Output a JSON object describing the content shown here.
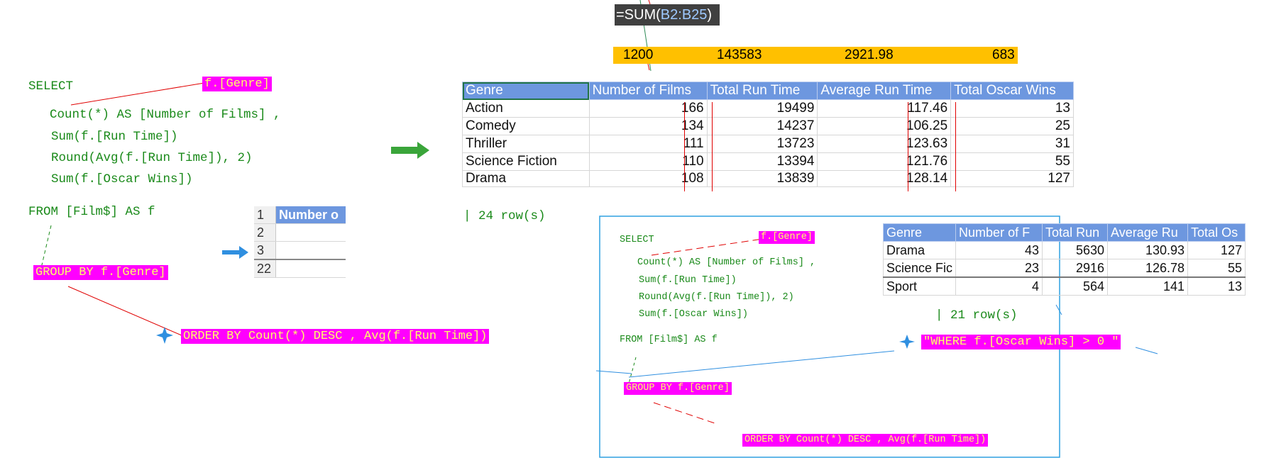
{
  "formula": {
    "prefix": "=SUM(",
    "ref": "B2:B25",
    "suffix": ")"
  },
  "totals": [
    "1200",
    "143583",
    "2921.98",
    "683"
  ],
  "left_query": {
    "select": "SELECT",
    "genre_tag": "f.[Genre]",
    "line_count": "Count(*) AS [Number of Films] ,",
    "line_sum_run": "Sum(f.[Run Time])",
    "line_round": "Round(Avg(f.[Run Time]), 2)",
    "line_sum_oscar": "Sum(f.[Oscar Wins])",
    "from": "FROM [Film$] AS f",
    "group_by": "GROUP BY f.[Genre]",
    "order_by": "ORDER BY Count(*) DESC , Avg(f.[Run Time])"
  },
  "main_table": {
    "headers": [
      "Genre",
      "Number of Films",
      "Total Run Time",
      "Average Run Time",
      "Total Oscar Wins"
    ],
    "rows": [
      [
        "Action",
        "166",
        "19499",
        "117.46",
        "13"
      ],
      [
        "Comedy",
        "134",
        "14237",
        "106.25",
        "25"
      ],
      [
        "Thriller",
        "111",
        "13723",
        "123.63",
        "31"
      ],
      [
        "Science Fiction",
        "110",
        "13394",
        "121.76",
        "55"
      ],
      [
        "Drama",
        "108",
        "13839",
        "128.14",
        "127"
      ]
    ],
    "row_count": "24 row(s)"
  },
  "mini_table": {
    "rows": [
      {
        "rn": "1",
        "val": "Number o"
      },
      {
        "rn": "2",
        "val": ""
      },
      {
        "rn": "3",
        "val": ""
      },
      {
        "rn": "22",
        "val": ""
      }
    ]
  },
  "right_query": {
    "select": "SELECT",
    "genre_tag": "f.[Genre]",
    "line_count": "Count(*) AS [Number of Films] ,",
    "line_sum_run": "Sum(f.[Run Time])",
    "line_round": "Round(Avg(f.[Run Time]), 2)",
    "line_sum_oscar": "Sum(f.[Oscar Wins])",
    "from": "FROM [Film$] AS f",
    "group_by": "GROUP BY f.[Genre]",
    "order_by": "ORDER BY Count(*) DESC , Avg(f.[Run Time])",
    "where": "\"WHERE f.[Oscar Wins] > 0 \""
  },
  "right_table": {
    "headers": [
      "Genre",
      "Number of F",
      "Total Run",
      "Average Ru",
      "Total Os"
    ],
    "rows": [
      [
        "Drama",
        "43",
        "5630",
        "130.93",
        "127"
      ],
      [
        "Science Fic",
        "23",
        "2916",
        "126.78",
        "55"
      ],
      [
        "Sport",
        "4",
        "564",
        "141",
        "13"
      ]
    ],
    "row_count": "21 row(s)"
  },
  "colors": {
    "highlight": "#ff00ff",
    "highlight_text": "#ffff66",
    "header_blue": "#6d97df",
    "totals_yellow": "#ffc000",
    "code_green": "#1a8a1a"
  }
}
